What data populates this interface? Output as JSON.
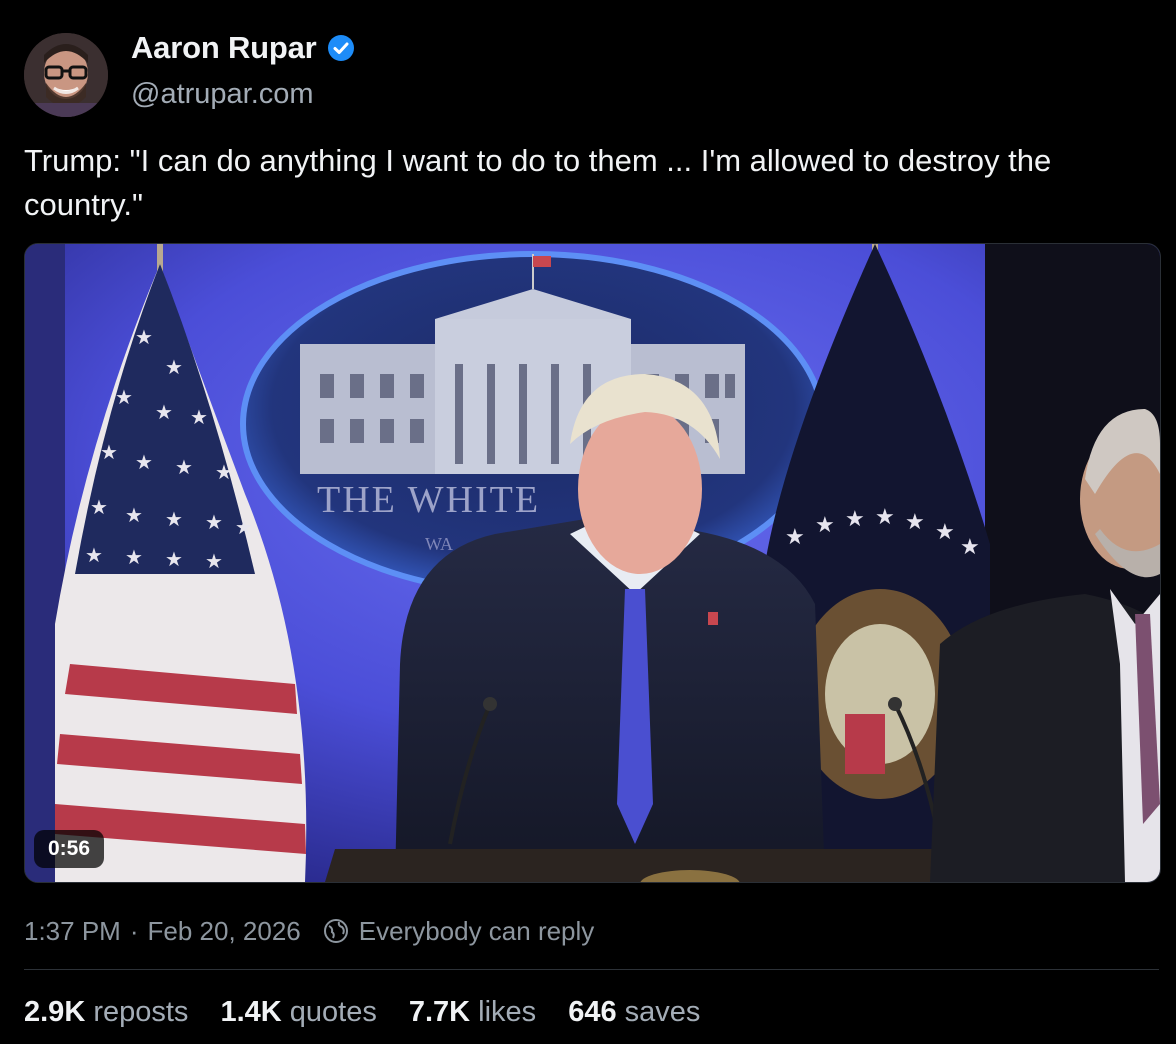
{
  "author": {
    "name": "Aaron Rupar",
    "handle": "@atrupar.com",
    "verified_icon": "verified-check-icon",
    "verified_color": "#1d8cf8"
  },
  "post": {
    "text": "Trump: \"I can do anything I want to do to them ... I'm allowed to destroy the country.\""
  },
  "video": {
    "duration": "0:56",
    "seal_text": "THE WHITE",
    "seal_subtext": "WA"
  },
  "meta": {
    "time": "1:37 PM",
    "separator": "·",
    "date": "Feb 20, 2026",
    "reply_icon": "globe-icon",
    "reply_setting": "Everybody can reply"
  },
  "stats": [
    {
      "value": "2.9K",
      "label": "reposts"
    },
    {
      "value": "1.4K",
      "label": "quotes"
    },
    {
      "value": "7.7K",
      "label": "likes"
    },
    {
      "value": "646",
      "label": "saves"
    }
  ],
  "colors": {
    "background": "#000000",
    "text": "#f1f3f5",
    "secondary_text": "#a3acb6",
    "accent": "#1d8cf8"
  }
}
